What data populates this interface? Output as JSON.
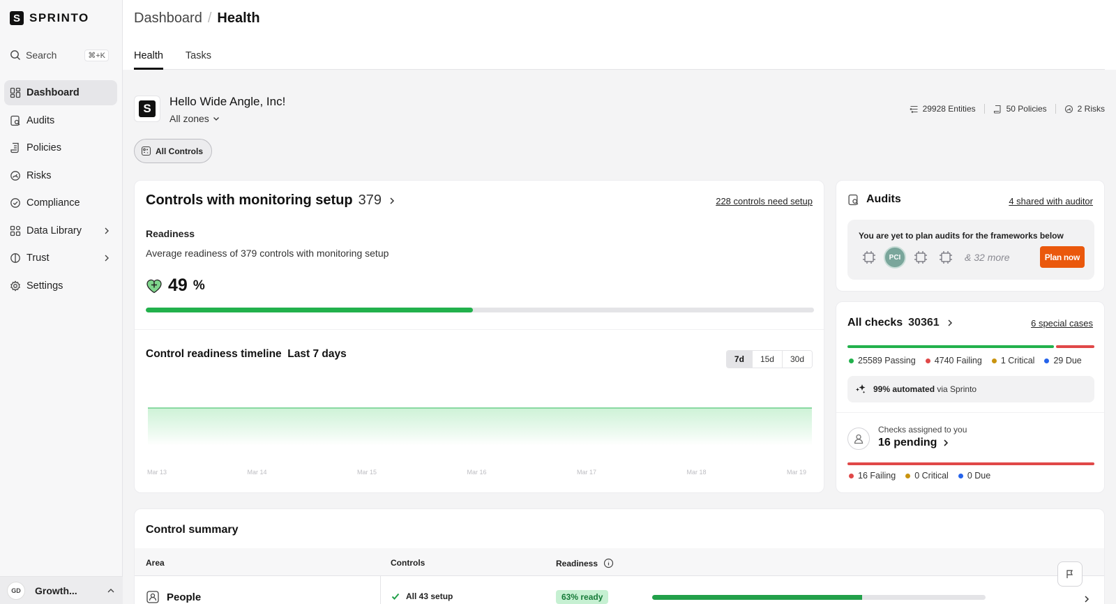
{
  "app": {
    "logo_letter": "S",
    "logo_text": "SPRINTO"
  },
  "search": {
    "label": "Search",
    "shortcut": "⌘+K"
  },
  "sidebar": {
    "items": [
      {
        "label": "Dashboard",
        "icon": "dashboard-icon",
        "active": true
      },
      {
        "label": "Audits",
        "icon": "audit-icon"
      },
      {
        "label": "Policies",
        "icon": "policy-icon"
      },
      {
        "label": "Risks",
        "icon": "risk-icon"
      },
      {
        "label": "Compliance",
        "icon": "check-circle-icon"
      },
      {
        "label": "Data Library",
        "icon": "grid-icon",
        "has_children": true
      },
      {
        "label": "Trust",
        "icon": "shield-icon",
        "has_children": true
      },
      {
        "label": "Settings",
        "icon": "gear-icon"
      }
    ],
    "user": {
      "initials": "GD",
      "name": "Growth..."
    }
  },
  "breadcrumb": {
    "parent": "Dashboard",
    "separator": "/",
    "current": "Health"
  },
  "tabs": [
    {
      "label": "Health",
      "active": true
    },
    {
      "label": "Tasks"
    }
  ],
  "company": {
    "logo_letter": "S",
    "greeting": "Hello Wide Angle, Inc!",
    "zones": "All zones",
    "stats": {
      "entities": "29928 Entities",
      "policies": "50 Policies",
      "risks": "2 Risks"
    }
  },
  "filter": {
    "label": "All Controls"
  },
  "controls": {
    "title": "Controls with monitoring setup",
    "count": "379",
    "setup_link": "228 controls need setup",
    "readiness_label": "Readiness",
    "readiness_desc": "Average readiness of 379 controls with monitoring setup",
    "readiness_value": "49",
    "readiness_unit": "%",
    "readiness_fraction": 0.49,
    "timeline_title": "Control readiness timeline",
    "timeline_period": "Last 7 days",
    "ranges": [
      {
        "label": "7d",
        "active": true
      },
      {
        "label": "15d"
      },
      {
        "label": "30d"
      }
    ]
  },
  "chart_data": {
    "type": "area",
    "x": [
      "Mar 13",
      "Mar 14",
      "Mar 15",
      "Mar 16",
      "Mar 17",
      "Mar 18",
      "Mar 19"
    ],
    "values": [
      49,
      49,
      49,
      49,
      49,
      49,
      49
    ],
    "ylim": [
      0,
      100
    ],
    "grid": false,
    "color": "#6ccf8a"
  },
  "audits": {
    "title": "Audits",
    "shared_link": "4 shared with auditor",
    "message": "You are yet to plan audits for the frameworks below",
    "frameworks": [
      {
        "label": "",
        "icon": "framework-icon"
      },
      {
        "label": "PCI",
        "icon": "pci-badge"
      },
      {
        "label": "",
        "icon": "framework-icon"
      },
      {
        "label": "",
        "icon": "framework-icon"
      }
    ],
    "more": "& 32 more",
    "plan_button": "Plan now"
  },
  "checks": {
    "title": "All checks",
    "count": "30361",
    "special_link": "6 special cases",
    "legend": [
      {
        "label": "25589 Passing",
        "color": "#22b14c",
        "value": 25589
      },
      {
        "label": "4740 Failing",
        "color": "#e04848",
        "value": 4740
      },
      {
        "label": "1 Critical",
        "color": "#c99410",
        "value": 1
      },
      {
        "label": "29 Due",
        "color": "#2563eb",
        "value": 29
      }
    ],
    "automated_pct": "99% automated",
    "automated_via": "via Sprinto",
    "assigned_label": "Checks assigned to you",
    "assigned_value": "16 pending",
    "assigned_legend": [
      {
        "label": "16 Failing",
        "color": "#e04848"
      },
      {
        "label": "0 Critical",
        "color": "#c99410"
      },
      {
        "label": "0 Due",
        "color": "#2563eb"
      }
    ]
  },
  "summary": {
    "title": "Control summary",
    "columns": {
      "area": "Area",
      "controls": "Controls",
      "readiness": "Readiness"
    },
    "rows": [
      {
        "area": "People",
        "controls": "All 43 setup",
        "readiness": "63% ready",
        "readiness_fraction": 0.63
      }
    ]
  }
}
